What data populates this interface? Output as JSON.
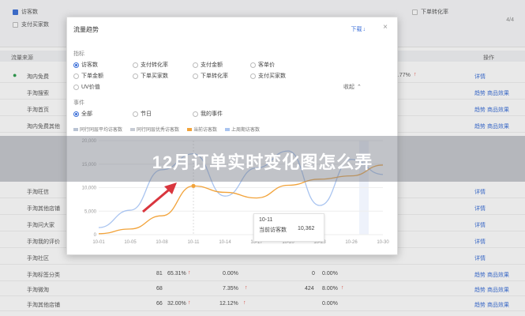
{
  "filters": {
    "checkboxes": [
      {
        "label": "访客数",
        "checked": true
      },
      {
        "label": "支付买家数",
        "checked": false
      }
    ],
    "right_checkbox": {
      "label": "下单转化率",
      "checked": false
    },
    "pager": "4/4"
  },
  "table": {
    "source_header": "流量来源",
    "op_header": "操作",
    "rows": [
      {
        "name": "淘内免费",
        "pct": "4.77%",
        "links": "详情"
      },
      {
        "name": "手淘搜索",
        "pct": "",
        "links": "趋势  商品效果"
      },
      {
        "name": "手淘首页",
        "pct": "",
        "links": "趋势  商品效果"
      },
      {
        "name": "淘内免费其他",
        "pct": "",
        "links": "趋势  商品效果"
      },
      {
        "name": "手淘拍立淘",
        "pct": "",
        "links": "趋势  商品效果"
      },
      {
        "name": "其他来源",
        "pct": "",
        "links": "趋势  商品效果"
      },
      {
        "name": "手淘旺信",
        "pct": "",
        "links": "详情"
      },
      {
        "name": "手淘其他店铺",
        "pct": "",
        "links": "详情"
      },
      {
        "name": "手淘问大家",
        "pct": "",
        "links": "详情"
      },
      {
        "name": "手淘我的评价",
        "pct": "",
        "links": "详情"
      },
      {
        "name": "手淘社区",
        "pct": "",
        "links": "详情"
      }
    ],
    "bottom_rows": [
      {
        "name": "手淘标签分类",
        "v1": "81",
        "p1": "65.31%",
        "v2": "0.00%",
        "v3": "0",
        "p2": "0.00%",
        "links": "趋势  商品效果"
      },
      {
        "name": "手淘微淘",
        "v1": "68",
        "p1": "",
        "v2": "7.35%",
        "v3": "424",
        "p2": "8.00%",
        "links": "趋势  商品效果"
      },
      {
        "name": "手淘其他店铺",
        "v1": "66",
        "p1": "32.00%",
        "v2": "12.12%",
        "v3": "",
        "p2": "0.00%",
        "links": "趋势  商品效果"
      }
    ]
  },
  "modal": {
    "title": "流量趋势",
    "download": "下载",
    "close": "×",
    "metrics_label": "指标",
    "metrics": [
      {
        "label": "访客数",
        "on": true
      },
      {
        "label": "支付转化率",
        "on": false
      },
      {
        "label": "支付金额",
        "on": false
      },
      {
        "label": "客单价",
        "on": false
      },
      {
        "label": "下单金额",
        "on": false
      },
      {
        "label": "下单买家数",
        "on": false
      },
      {
        "label": "下单转化率",
        "on": false
      },
      {
        "label": "支付买家数",
        "on": false
      },
      {
        "label": "UV价值",
        "on": false
      }
    ],
    "collapse": "收起",
    "events_label": "事件",
    "events": [
      {
        "label": "全部",
        "on": true
      },
      {
        "label": "节日",
        "on": false
      },
      {
        "label": "我的事件",
        "on": false
      }
    ],
    "legend": [
      "同行同层平均访客数",
      "同行同层优秀访客数",
      "当前访客数",
      "上周期访客数"
    ],
    "tooltip": {
      "date": "10-11",
      "label": "当前访客数",
      "value": "10,362"
    }
  },
  "chart_data": {
    "type": "line",
    "x": [
      "10-01",
      "10-05",
      "10-08",
      "10-11",
      "10-14",
      "10-17",
      "10-20",
      "10-23",
      "10-26",
      "10-30"
    ],
    "y_ticks": [
      "0",
      "5,000",
      "10,000",
      "15,000",
      "20,000"
    ],
    "ylim": [
      0,
      20000
    ],
    "series": [
      {
        "name": "当前访客数",
        "color": "#f2a33a",
        "values": [
          200,
          1200,
          4000,
          10362,
          9000,
          7800,
          10500,
          11800,
          12500,
          14800
        ]
      },
      {
        "name": "上周期访客数",
        "color": "#a9c4f0",
        "values": [
          1500,
          5200,
          13800,
          17200,
          8200,
          14200,
          17800,
          6200,
          16000,
          12800
        ]
      }
    ],
    "highlight_x": "10-11"
  },
  "banner": {
    "text": "12月订单实时变化图怎么弄"
  },
  "colors": {
    "accent": "#3b6fd8",
    "up": "#e64a3c",
    "current": "#f2a33a",
    "previous": "#a9c4f0"
  }
}
